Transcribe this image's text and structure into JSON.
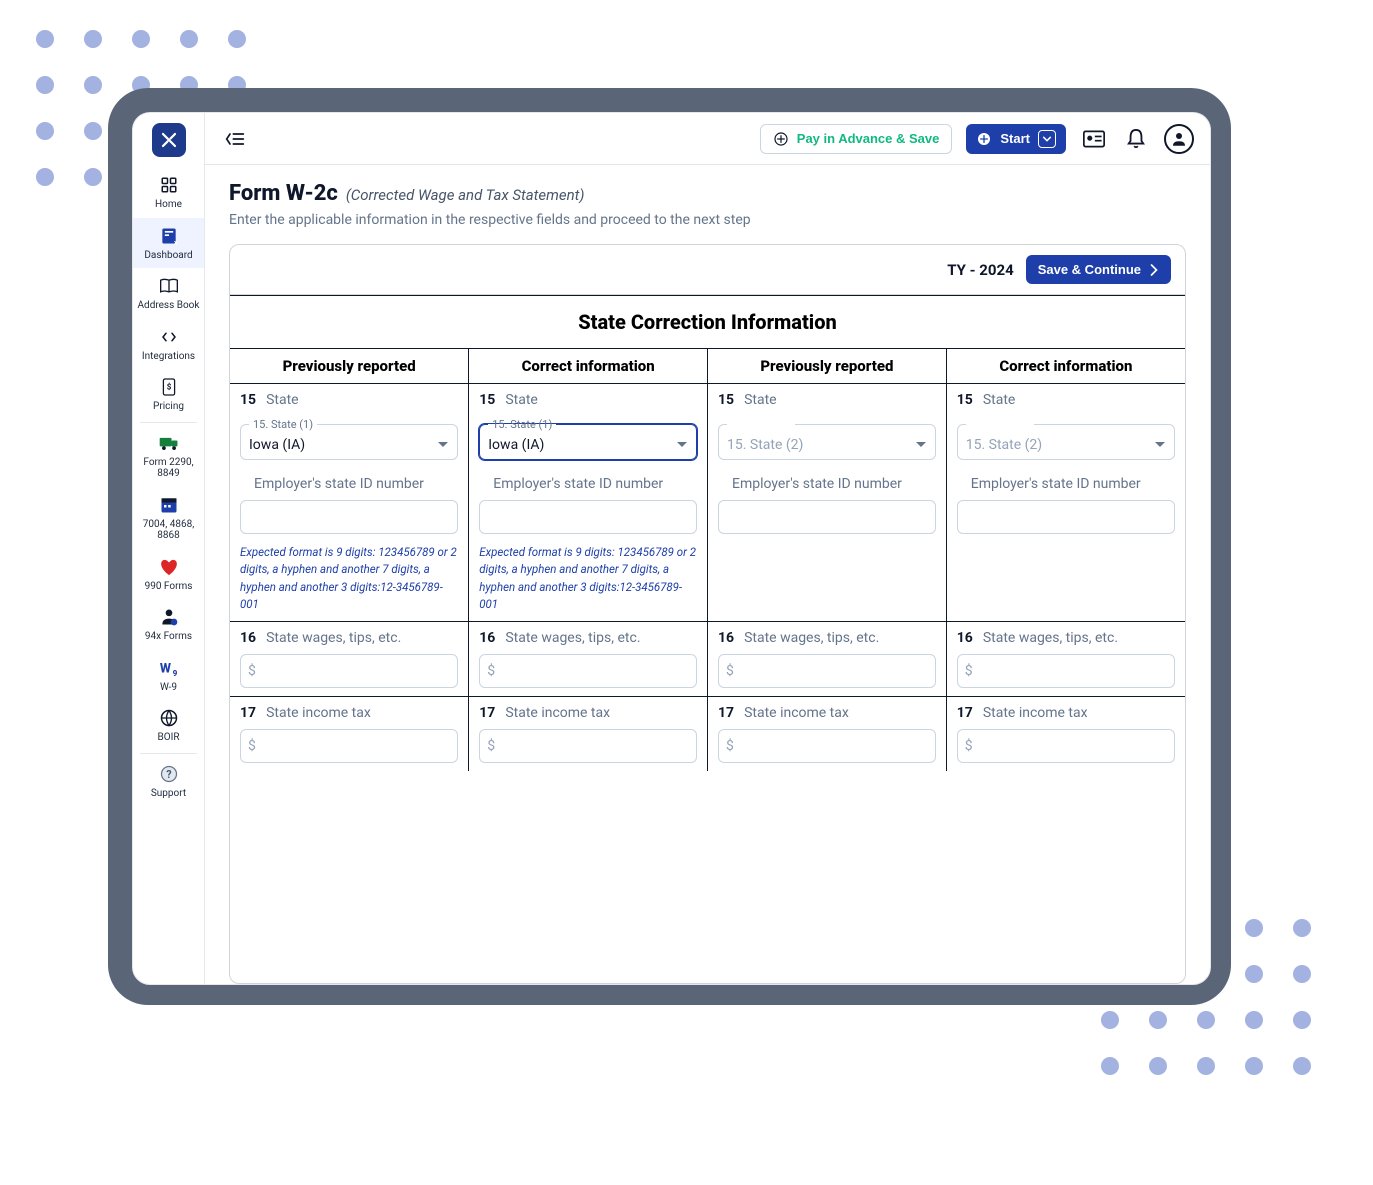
{
  "decor": {
    "dot_count": 20
  },
  "sidebar": {
    "items": [
      {
        "label": "Home",
        "icon": "grid-icon"
      },
      {
        "label": "Dashboard",
        "icon": "dashboard-icon",
        "active": true
      },
      {
        "label": "Address Book",
        "icon": "book-icon"
      },
      {
        "label": "Integrations",
        "icon": "integrations-icon"
      },
      {
        "label": "Pricing",
        "icon": "pricing-icon"
      },
      {
        "label": "Form 2290, 8849",
        "icon": "truck-icon"
      },
      {
        "label": "7004, 4868, 8868",
        "icon": "calendar-icon"
      },
      {
        "label": "990 Forms",
        "icon": "heart-icon"
      },
      {
        "label": "94x Forms",
        "icon": "person-icon"
      },
      {
        "label": "W-9",
        "icon": "w9-icon"
      },
      {
        "label": "BOIR",
        "icon": "globe-icon"
      },
      {
        "label": "Support",
        "icon": "support-icon"
      }
    ]
  },
  "topbar": {
    "pay_label": "Pay in Advance & Save",
    "start_label": "Start"
  },
  "page": {
    "title": "Form W-2c",
    "subtitle": "(Corrected Wage and Tax Statement)",
    "desc": "Enter the applicable information in the respective fields and proceed to the next step"
  },
  "panel": {
    "tax_year": "TY - 2024",
    "save_label": "Save & Continue"
  },
  "section": {
    "title": "State Correction Information",
    "headers": {
      "h1": "Previously reported",
      "h2": "Correct information",
      "h3": "Previously reported",
      "h4": "Correct information"
    },
    "lines": {
      "l15": "State",
      "l15no": "15",
      "legend1": "15. State (1)",
      "legend2": "15. State (2)",
      "state1_value": "Iowa (IA)",
      "state2_placeholder": "15. State (2)",
      "employer_id_label": "Employer's state ID number",
      "format_hint": "Expected format is 9 digits: 123456789 or 2 digits, a hyphen and another 7 digits, a hyphen and another 3 digits:12-3456789-001",
      "l16no": "16",
      "l16": "State wages, tips, etc.",
      "l17no": "17",
      "l17": "State income tax",
      "dollar": "$"
    }
  }
}
